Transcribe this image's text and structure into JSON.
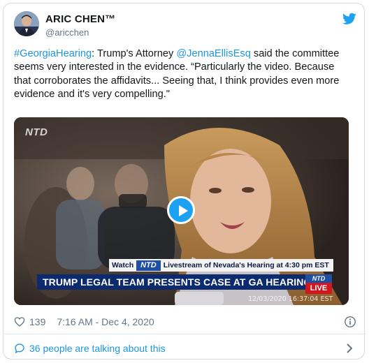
{
  "author": {
    "display_name": "ARIC CHEN™",
    "handle": "@aricchen"
  },
  "tweet": {
    "hashtag": "#GeorgiaHearing",
    "text_part1": ": Trump's Attorney ",
    "mention": "@JennaEllisEsq",
    "text_part2": " said the committee seems very interested in the evidence. “Particularly the video. Because that corroborates the affidavits... Seeing that, I think provides even more evidence and it's very compelling.\""
  },
  "media": {
    "watermark": "NTD",
    "ticker_watch": "Watch",
    "ticker_ntd": "NTD",
    "ticker_text": "Livestream of Nevada's Hearing at 4:30 pm EST",
    "headline": "TRUMP LEGAL TEAM PRESENTS CASE AT GA HEARING",
    "live_top": "NTD",
    "live_bottom": "LIVE",
    "timestamp": "12/03/2020 16:37:04 EST"
  },
  "meta": {
    "likes": "139",
    "time": "7:16 AM - Dec 4, 2020"
  },
  "footer": {
    "conversation": "36 people are talking about this"
  },
  "colors": {
    "link": "#1b95e0",
    "twitter_blue": "#1da1f2",
    "secondary_text": "#657786"
  },
  "icons": [
    "twitter-bird-icon",
    "play-icon",
    "heart-icon",
    "info-icon",
    "speech-bubble-icon",
    "chevron-right-icon"
  ]
}
